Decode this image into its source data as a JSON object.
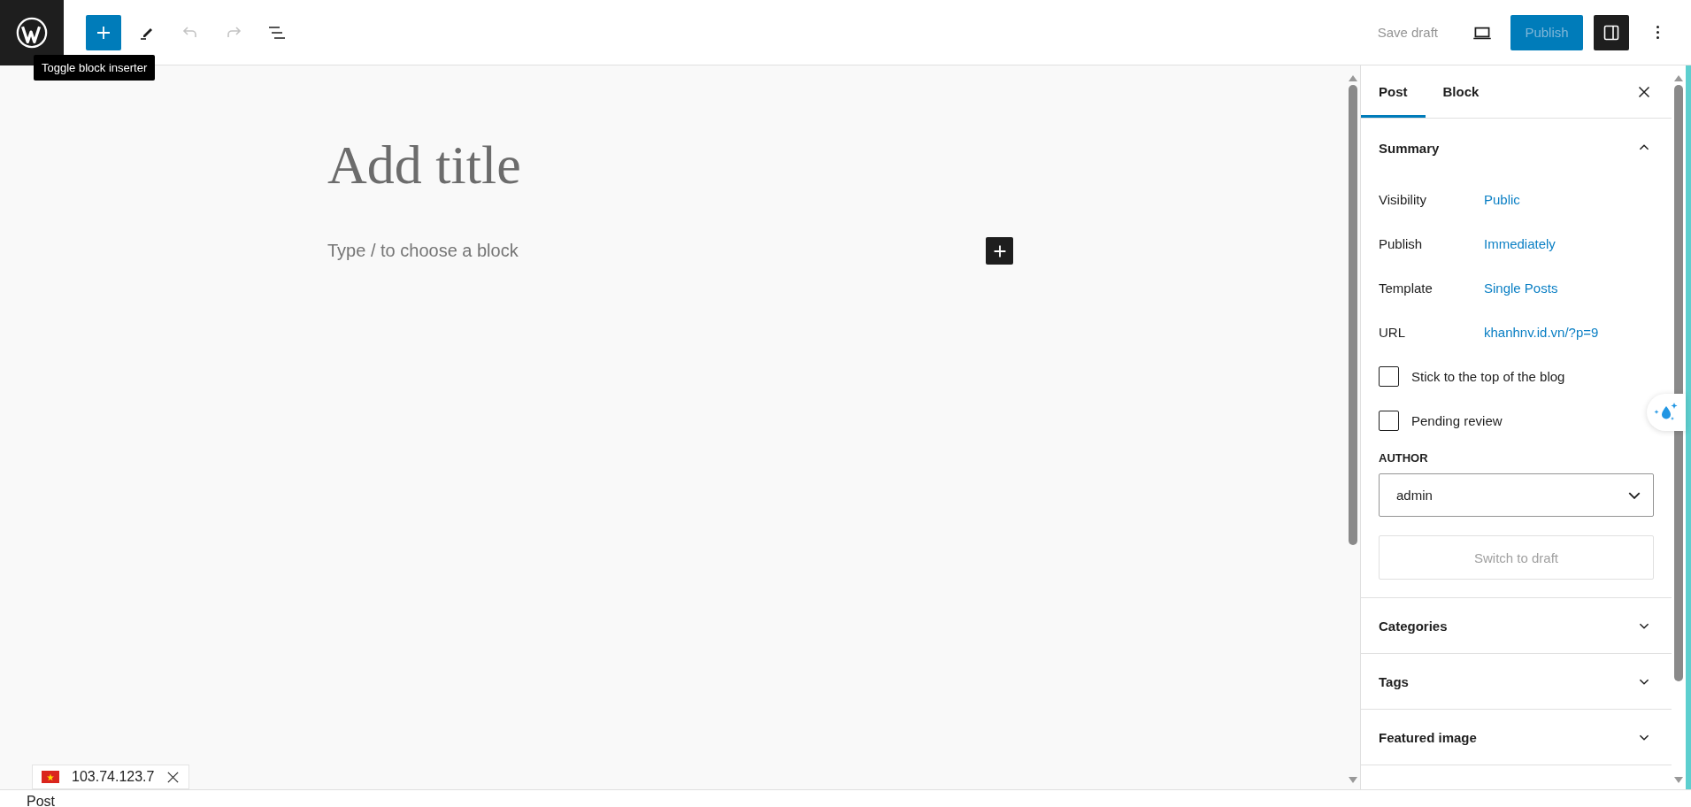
{
  "toolbar": {
    "inserter": {
      "pressed": true
    },
    "undo": {
      "disabled": true
    },
    "redo": {
      "disabled": true
    },
    "tooltip": "Toggle block inserter",
    "save_draft": "Save draft",
    "publish": "Publish",
    "settings": {
      "pressed": true
    }
  },
  "editor": {
    "title_placeholder": "Add title",
    "block_placeholder": "Type / to choose a block"
  },
  "sidebar": {
    "tabs": [
      {
        "label": "Post",
        "selected": true
      },
      {
        "label": "Block",
        "selected": false
      }
    ],
    "summary": {
      "title": "Summary",
      "expanded": true,
      "rows": [
        {
          "label": "Visibility",
          "value": "Public"
        },
        {
          "label": "Publish",
          "value": "Immediately"
        },
        {
          "label": "Template",
          "value": "Single Posts"
        },
        {
          "label": "URL",
          "value": "khanhnv.id.vn/?p=9"
        }
      ],
      "checkboxes": [
        {
          "label": "Stick to the top of the blog",
          "checked": false
        },
        {
          "label": "Pending review",
          "checked": false
        }
      ],
      "author_label": "AUTHOR",
      "author": "admin",
      "switch_button": "Switch to draft"
    },
    "panels": [
      {
        "title": "Categories",
        "expanded": false
      },
      {
        "title": "Tags",
        "expanded": false
      },
      {
        "title": "Featured image",
        "expanded": false
      }
    ]
  },
  "ip_badge": "103.74.123.7",
  "footer": "Post"
}
